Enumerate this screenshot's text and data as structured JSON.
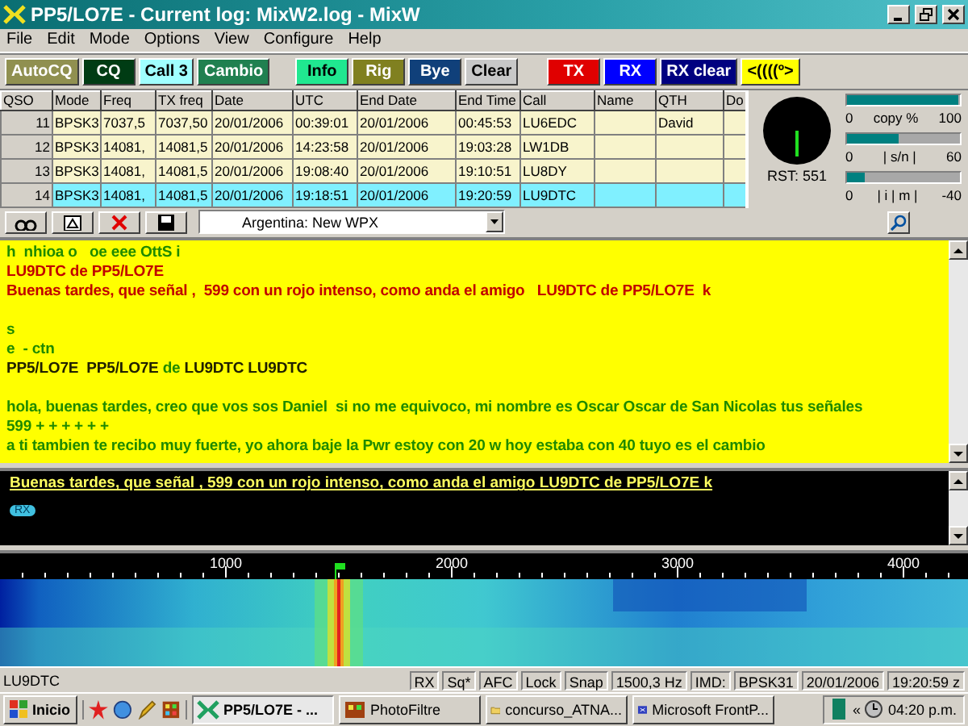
{
  "window": {
    "title": "PP5/LO7E - Current log: MixW2.log - MixW"
  },
  "menu": [
    "File",
    "Edit",
    "Mode",
    "Options",
    "View",
    "Configure",
    "Help"
  ],
  "toolbar": [
    {
      "label": "AutoCQ",
      "color": "#909050"
    },
    {
      "label": "CQ",
      "color": "#003c14"
    },
    {
      "label": "Call 3",
      "color": "#a0ffff"
    },
    {
      "label": "Cambio",
      "color": "#208050"
    },
    {
      "label": "Info",
      "color": "#20e890"
    },
    {
      "label": "Rig",
      "color": "#808020"
    },
    {
      "label": "Bye",
      "color": "#10407a"
    },
    {
      "label": "Clear",
      "color": "#c8c8c8"
    },
    {
      "label": "TX",
      "color": "#e00000"
    },
    {
      "label": "RX",
      "color": "#0000ff"
    },
    {
      "label": "RX clear",
      "color": "#000080"
    },
    {
      "label": "<((((º>",
      "color": "#ffff00"
    }
  ],
  "log": {
    "columns": [
      "QSO",
      "Mode",
      "Freq",
      "TX freq",
      "Date",
      "UTC",
      "End Date",
      "End Time",
      "Call",
      "Name",
      "QTH",
      "Do"
    ],
    "rows": [
      {
        "selected": false,
        "cells": [
          "11",
          "BPSK3",
          "7037,5",
          "7037,50",
          "20/01/2006",
          "00:39:01",
          "20/01/2006",
          "00:45:53",
          "LU6EDC",
          "",
          "David",
          ""
        ]
      },
      {
        "selected": false,
        "cells": [
          "12",
          "BPSK3",
          "14081,",
          "14081,5",
          "20/01/2006",
          "14:23:58",
          "20/01/2006",
          "19:03:28",
          "LW1DB",
          "",
          "",
          ""
        ]
      },
      {
        "selected": false,
        "cells": [
          "13",
          "BPSK3",
          "14081,",
          "14081,5",
          "20/01/2006",
          "19:08:40",
          "20/01/2006",
          "19:10:51",
          "LU8DY",
          "",
          "",
          ""
        ]
      },
      {
        "selected": true,
        "cells": [
          "14",
          "BPSK3",
          "14081,",
          "14081,5",
          "20/01/2006",
          "19:18:51",
          "20/01/2006",
          "19:20:59",
          "LU9DTC",
          "",
          "",
          ""
        ]
      }
    ]
  },
  "meters": [
    {
      "min": "0",
      "label": "copy %",
      "max": "100",
      "level": 0.98
    },
    {
      "min": "0",
      "label": "| s/n |",
      "max": "60",
      "level": 0.45
    },
    {
      "min": "0",
      "label": "| i | m |",
      "max": "-40",
      "level": 0.15
    }
  ],
  "scope": {
    "reading": "RST: 551"
  },
  "lookup": {
    "value": "Argentina:  New WPX"
  },
  "rx_text": [
    {
      "gap_before": false,
      "segments": [
        {
          "text": "h  nhioa o   oe eee OttS i",
          "kind": "rx"
        }
      ]
    },
    {
      "gap_before": false,
      "segments": [
        {
          "text": "LU9DTC de PP5/LO7E",
          "kind": "tx"
        }
      ]
    },
    {
      "gap_before": false,
      "segments": [
        {
          "text": "Buenas tardes, que señal ,  599 con un rojo intenso, como anda el amigo   LU9DTC de PP5/LO7E  k",
          "kind": "tx"
        }
      ]
    },
    {
      "gap_before": true,
      "segments": [
        {
          "text": "s",
          "kind": "rx"
        }
      ]
    },
    {
      "gap_before": false,
      "segments": [
        {
          "text": "e  - ctn",
          "kind": "rx"
        }
      ]
    },
    {
      "gap_before": false,
      "segments": [
        {
          "text": "PP5/LO7E  PP5/LO7E",
          "kind": "call"
        },
        {
          "text": "de",
          "kind": "rx"
        },
        {
          "text": "LU9DTC LU9DTC",
          "kind": "call"
        }
      ]
    },
    {
      "gap_before": true,
      "segments": [
        {
          "text": "hola, buenas tardes, creo que vos sos Daniel  si no me equivoco, mi nombre es Oscar Oscar de San Nicolas tus señales",
          "kind": "rx"
        }
      ]
    },
    {
      "gap_before": false,
      "segments": [
        {
          "text": "599 + + + + + +",
          "kind": "rx"
        }
      ]
    },
    {
      "gap_before": false,
      "segments": [
        {
          "text": "a ti tambien te recibo muy fuerte, yo ahora baje la Pwr estoy con 20 w hoy estaba con 40 tuyo es el cambio",
          "kind": "rx"
        }
      ]
    }
  ],
  "tx_text": {
    "text": "Buenas tardes, que señal ,  599 con un rojo intenso, como anda el amigo   LU9DTC de PP5/LO7E  k",
    "badge": "RX"
  },
  "waterfall": {
    "scale_labels": [
      "1000",
      "2000",
      "3000",
      "4000"
    ]
  },
  "status_bar": {
    "call": "LU9DTC",
    "fields": [
      "RX",
      "Sq*",
      "AFC",
      "Lock",
      "Snap",
      "1500,3 Hz",
      "IMD:",
      "BPSK31",
      "20/01/2006",
      "19:20:59 z"
    ]
  },
  "taskbar": {
    "start": "Inicio",
    "tasks": [
      {
        "label": "PP5/LO7E - ...",
        "selected": true
      },
      {
        "label": "PhotoFiltre",
        "selected": false
      },
      {
        "label": "concurso_ATNA...",
        "selected": false
      },
      {
        "label": "Microsoft FrontP...",
        "selected": false
      }
    ],
    "tray_expand": "«",
    "clock": "04:20 p.m."
  }
}
